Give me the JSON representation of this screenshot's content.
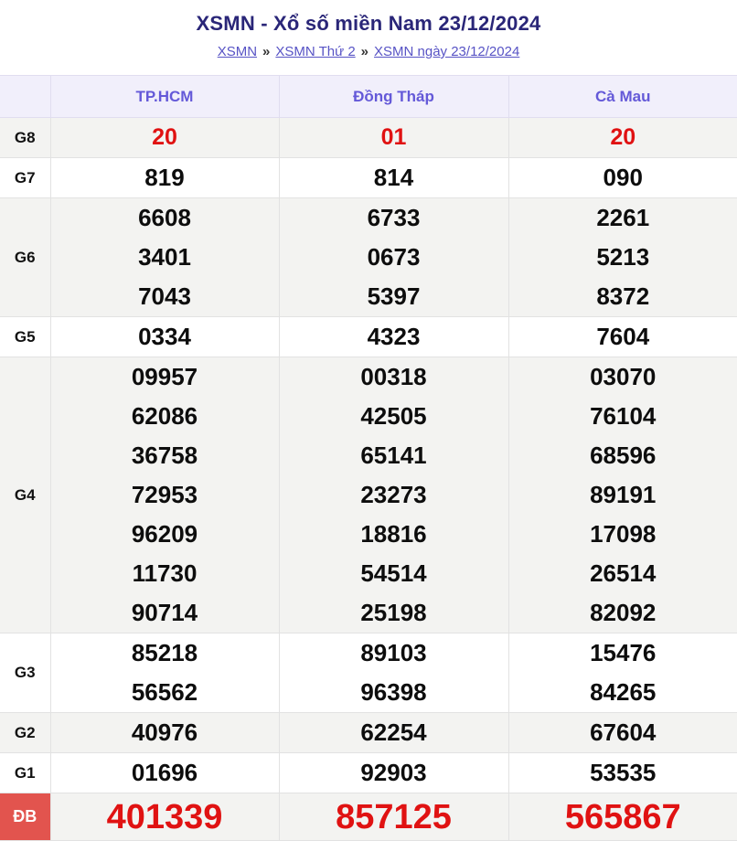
{
  "page": {
    "title": "XSMN - Xổ số miền Nam 23/12/2024",
    "breadcrumb": {
      "separator": "»",
      "items": [
        {
          "label": "XSMN"
        },
        {
          "label": "XSMN Thứ 2"
        },
        {
          "label": "XSMN ngày 23/12/2024"
        }
      ]
    }
  },
  "table": {
    "columns": [
      "TP.HCM",
      "Đồng Tháp",
      "Cà Mau"
    ],
    "rows": [
      {
        "prize": "G8",
        "highlight": "red",
        "values": [
          [
            "20"
          ],
          [
            "01"
          ],
          [
            "20"
          ]
        ]
      },
      {
        "prize": "G7",
        "highlight": "none",
        "values": [
          [
            "819"
          ],
          [
            "814"
          ],
          [
            "090"
          ]
        ]
      },
      {
        "prize": "G6",
        "highlight": "none",
        "values": [
          [
            "6608",
            "3401",
            "7043"
          ],
          [
            "6733",
            "0673",
            "5397"
          ],
          [
            "2261",
            "5213",
            "8372"
          ]
        ]
      },
      {
        "prize": "G5",
        "highlight": "none",
        "values": [
          [
            "0334"
          ],
          [
            "4323"
          ],
          [
            "7604"
          ]
        ]
      },
      {
        "prize": "G4",
        "highlight": "none",
        "values": [
          [
            "09957",
            "62086",
            "36758",
            "72953",
            "96209",
            "11730",
            "90714"
          ],
          [
            "00318",
            "42505",
            "65141",
            "23273",
            "18816",
            "54514",
            "25198"
          ],
          [
            "03070",
            "76104",
            "68596",
            "89191",
            "17098",
            "26514",
            "82092"
          ]
        ]
      },
      {
        "prize": "G3",
        "highlight": "none",
        "values": [
          [
            "85218",
            "56562"
          ],
          [
            "89103",
            "96398"
          ],
          [
            "15476",
            "84265"
          ]
        ]
      },
      {
        "prize": "G2",
        "highlight": "none",
        "values": [
          [
            "40976"
          ],
          [
            "62254"
          ],
          [
            "67604"
          ]
        ]
      },
      {
        "prize": "G1",
        "highlight": "none",
        "values": [
          [
            "01696"
          ],
          [
            "92903"
          ],
          [
            "53535"
          ]
        ]
      },
      {
        "prize": "ĐB",
        "highlight": "special",
        "values": [
          [
            "401339"
          ],
          [
            "857125"
          ],
          [
            "565867"
          ]
        ]
      }
    ]
  },
  "colors": {
    "title_color": "#2a2678",
    "link_color": "#5753c5",
    "header_bg": "#f1effb",
    "header_text": "#6459d8",
    "row_gray": "#f3f3f1",
    "row_white": "#ffffff",
    "border_color": "#e2e2e2",
    "number_color": "#0d0d0d",
    "red_value": "#e01212",
    "special_bg": "#e2544e",
    "special_label_text": "#ffffff"
  }
}
